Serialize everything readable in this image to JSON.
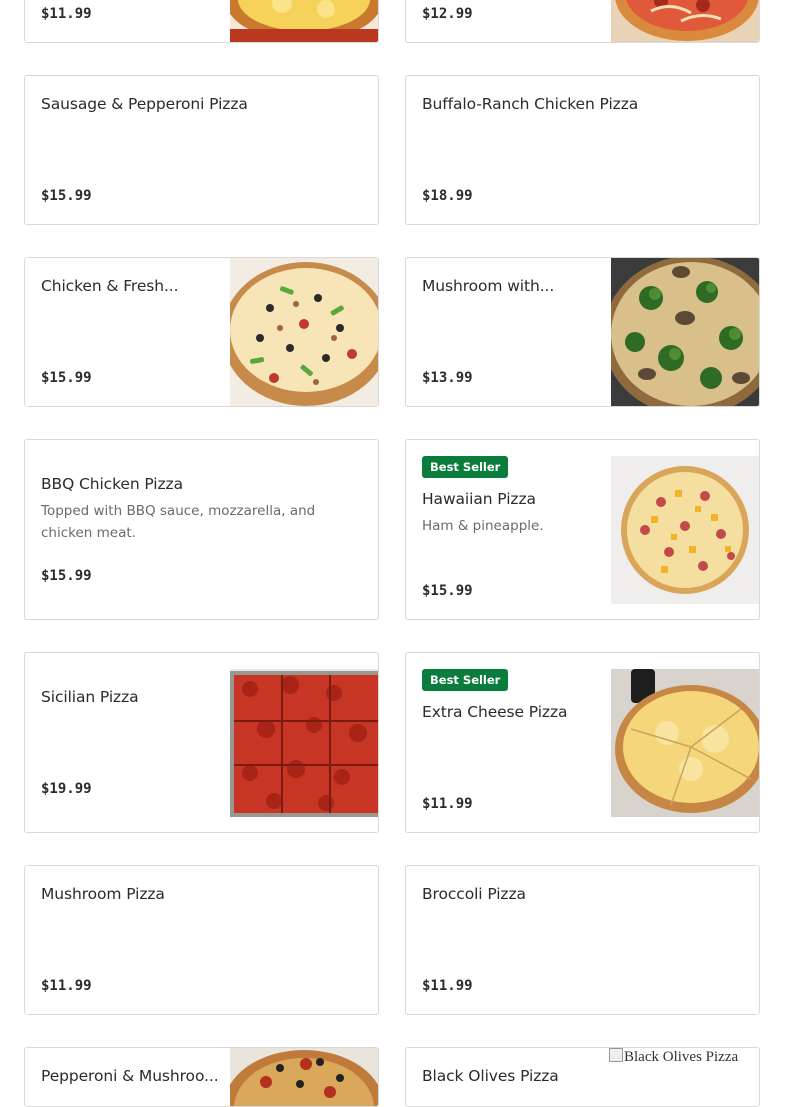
{
  "menu": {
    "items": [
      {
        "id": "row0-left",
        "name": "",
        "price": "$11.99"
      },
      {
        "id": "row0-right",
        "name": "",
        "price": "$12.99"
      },
      {
        "id": "sausage-pepperoni",
        "name": "Sausage & Pepperoni Pizza",
        "price": "$15.99"
      },
      {
        "id": "buffalo-ranch",
        "name": "Buffalo-Ranch Chicken Pizza",
        "price": "$18.99"
      },
      {
        "id": "chicken-fresh",
        "name": "Chicken & Fresh...",
        "price": "$15.99"
      },
      {
        "id": "mushroom-with",
        "name": "Mushroom with...",
        "price": "$13.99"
      },
      {
        "id": "bbq-chicken",
        "name": "BBQ Chicken Pizza",
        "description": "Topped with BBQ sauce, mozzarella, and chicken meat.",
        "price": "$15.99"
      },
      {
        "id": "hawaiian",
        "badge": "Best Seller",
        "name": "Hawaiian Pizza",
        "description": "Ham & pineapple.",
        "price": "$15.99"
      },
      {
        "id": "sicilian",
        "name": "Sicilian Pizza",
        "price": "$19.99"
      },
      {
        "id": "extra-cheese",
        "badge": "Best Seller",
        "name": "Extra Cheese Pizza",
        "price": "$11.99"
      },
      {
        "id": "mushroom",
        "name": "Mushroom Pizza",
        "price": "$11.99"
      },
      {
        "id": "broccoli",
        "name": "Broccoli Pizza",
        "price": "$11.99"
      },
      {
        "id": "pepperoni-mushroom",
        "name": "Pepperoni & Mushroo...",
        "price": ""
      },
      {
        "id": "black-olives",
        "name": "Black Olives Pizza",
        "image_alt": "Black Olives Pizza",
        "price": ""
      }
    ]
  },
  "colors": {
    "badge_bg": "#0a7d3c",
    "card_border": "#d9d9d9",
    "text_primary": "#2b2b2b",
    "text_secondary": "#6b6b6b"
  }
}
